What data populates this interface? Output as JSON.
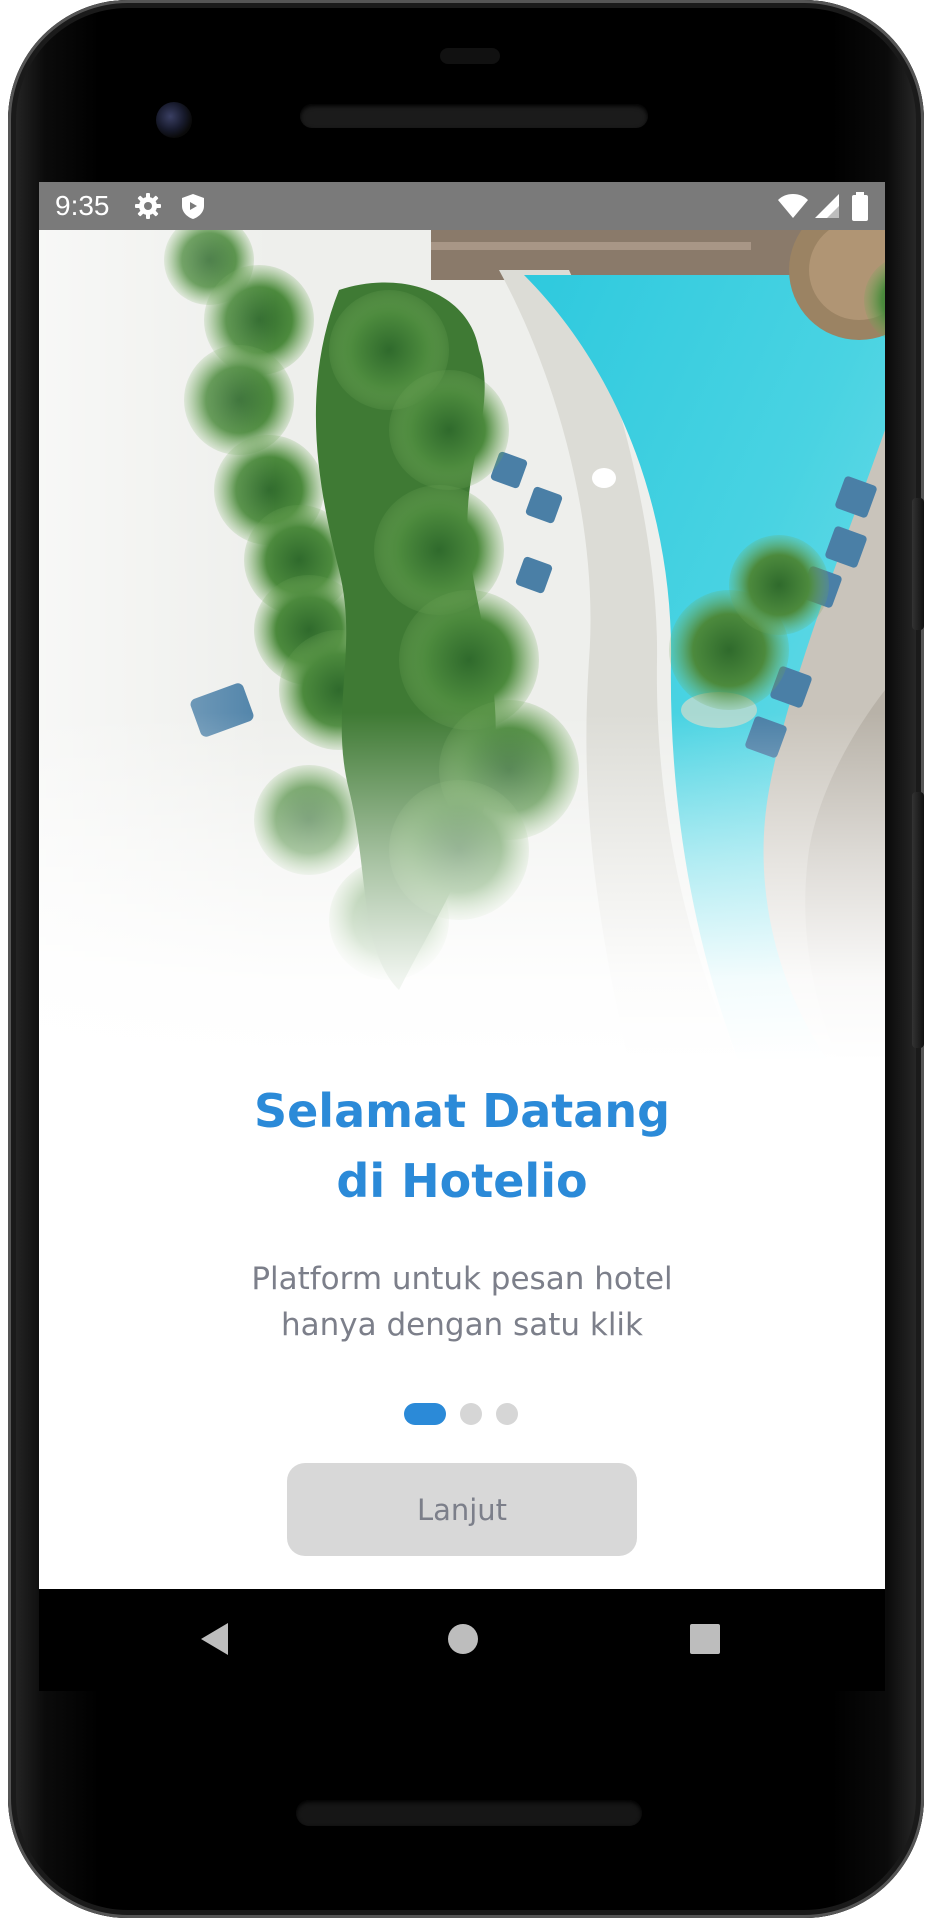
{
  "status_bar": {
    "time": "9:35",
    "left_icons": [
      "settings-gear-icon",
      "shield-icon"
    ],
    "right_icons": [
      "wifi-icon",
      "cellular-signal-icon",
      "battery-icon"
    ],
    "background_color": "#7a7a7a"
  },
  "onboarding": {
    "hero_image": "aerial-resort-pool-palms-image",
    "title_line1": "Selamat Datang",
    "title_line2": "di Hotelio",
    "subtitle": "Platform untuk  pesan hotel\n hanya dengan satu klik",
    "pagination": {
      "total": 3,
      "active_index": 0
    },
    "next_button_label": "Lanjut"
  },
  "navigation_bar": {
    "buttons": [
      "back-icon",
      "home-icon",
      "recents-icon"
    ]
  },
  "colors": {
    "accent": "#2b8ad8",
    "subtitle_text": "#7c7f8a",
    "button_background": "#d8d8d8",
    "dot_inactive": "#d6d6d6"
  }
}
